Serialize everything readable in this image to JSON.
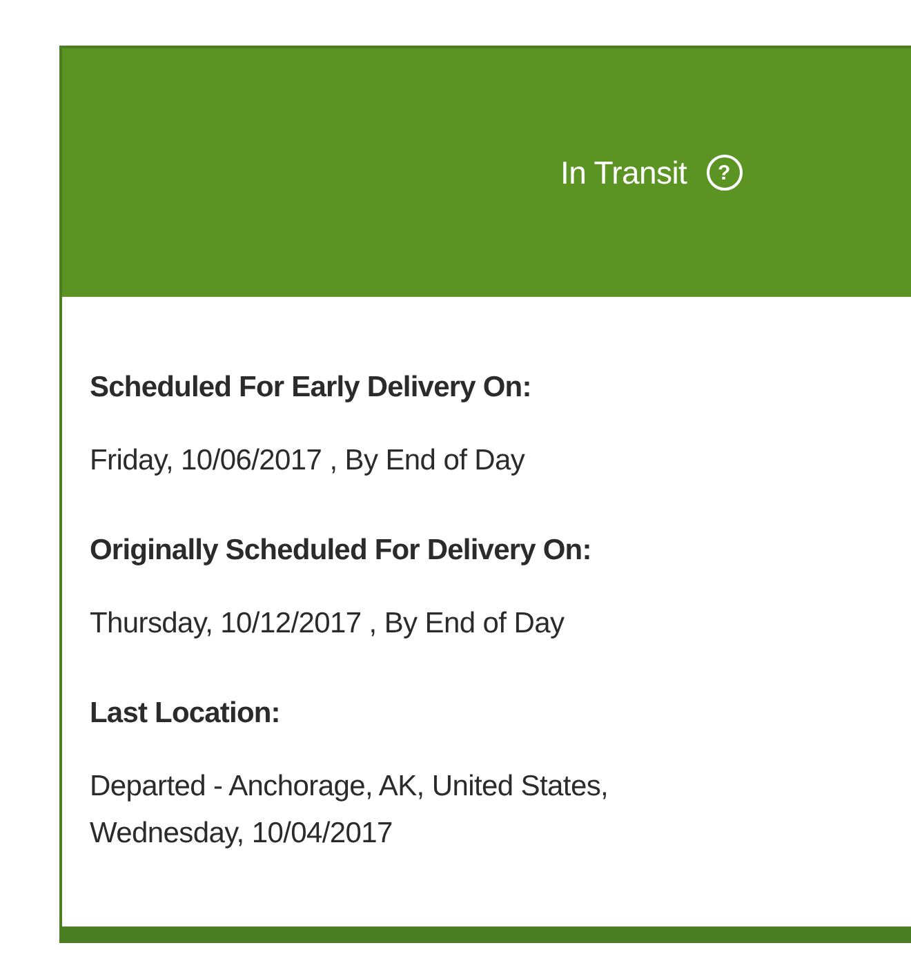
{
  "status": {
    "label": "In Transit",
    "help_icon": "?"
  },
  "details": [
    {
      "heading": "Scheduled For Early Delivery On:",
      "value": "Friday, 10/06/2017 , By End of Day"
    },
    {
      "heading": "Originally Scheduled For Delivery On:",
      "value": "Thursday, 10/12/2017 , By End of Day"
    },
    {
      "heading": "Last Location:",
      "value": "Departed - Anchorage, AK, United States,\nWednesday, 10/04/2017"
    }
  ]
}
